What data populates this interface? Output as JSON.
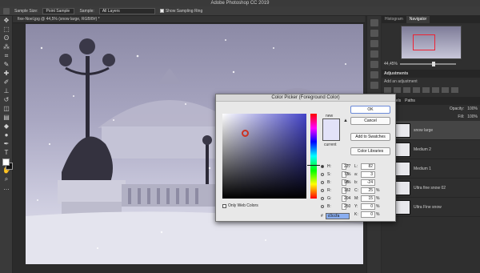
{
  "app": {
    "title": "Adobe Photoshop CC 2019"
  },
  "options_bar": {
    "sample_size_label": "Sample Size:",
    "sample_size_value": "Point Sample",
    "sample_label": "Sample:",
    "sample_value": "All Layers",
    "show_ring_label": "Show Sampling Ring"
  },
  "document": {
    "tab_label": "fixe-Noel.jpg @ 44,5% (snow large, RGB/8#) *"
  },
  "navigator": {
    "tabs": [
      "Histogram",
      "Navigator"
    ],
    "zoom": "44,45%"
  },
  "adjustments": {
    "title": "Adjustments",
    "subtitle": "Add an adjustment"
  },
  "layers": {
    "tabs": [
      "Channels",
      "Paths"
    ],
    "opacity_label": "Opacity:",
    "opacity_value": "100%",
    "fill_label": "Fill:",
    "fill_value": "100%",
    "items": [
      {
        "name": "snow large",
        "selected": true
      },
      {
        "name": "Medium 2",
        "selected": false
      },
      {
        "name": "Medium 1",
        "selected": false
      },
      {
        "name": "Ultra fine snow 02",
        "selected": false
      },
      {
        "name": "Ultra Fine snow",
        "selected": false
      }
    ]
  },
  "color_picker": {
    "title": "Color Picker (Foreground Color)",
    "ok": "OK",
    "cancel": "Cancel",
    "add_to_swatches": "Add to Swatches",
    "color_libraries": "Color Libraries",
    "new_label": "new",
    "current_label": "current",
    "only_web_colors": "Only Web Colors",
    "color_hex_value": "#e2e2f8",
    "hsb": {
      "H": "227",
      "S": "73",
      "B": "98"
    },
    "rgb": {
      "R": "182",
      "G": "204",
      "B": "250"
    },
    "lab": {
      "L": "82",
      "a": "3",
      "b": "-24"
    },
    "cmyk": {
      "C": "25",
      "M": "15",
      "Y": "0",
      "K": "0"
    },
    "units": {
      "H": "°",
      "S": "%",
      "B": "%",
      "C": "%",
      "M": "%",
      "Y": "%",
      "K": "%"
    },
    "hex_label": "#",
    "hex": "c0ccfa"
  }
}
